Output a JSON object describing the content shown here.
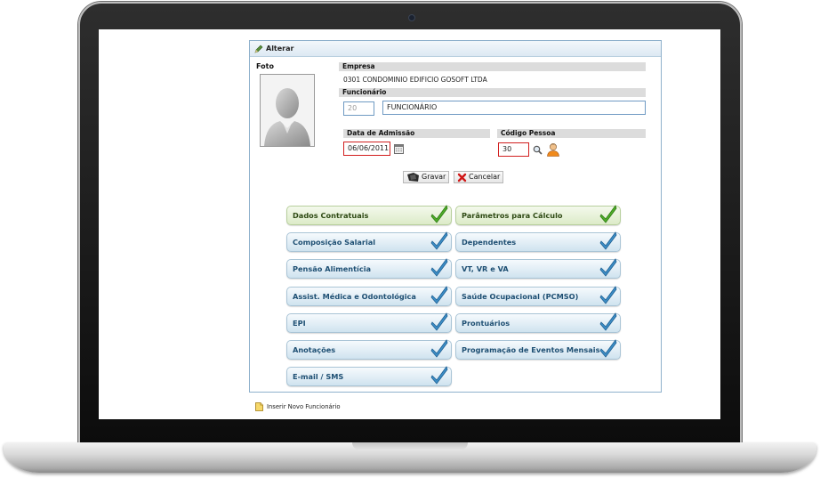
{
  "panel": {
    "title": "Alterar"
  },
  "photo": {
    "label": "Foto"
  },
  "empresa": {
    "label": "Empresa",
    "value": "0301 CONDOMINIO EDIFICIO GOSOFT LTDA"
  },
  "funcionario": {
    "label": "Funcionário",
    "code": "20",
    "name": "FUNCIONÁRIO"
  },
  "admissao": {
    "label": "Data de Admissão",
    "value": "06/06/2011"
  },
  "codigo_pessoa": {
    "label": "Código Pessoa",
    "value": "30"
  },
  "actions": {
    "save": "Gravar",
    "cancel": "Cancelar"
  },
  "menu": {
    "items": [
      {
        "label": "Dados Contratuais",
        "style": "green"
      },
      {
        "label": "Parâmetros para Cálculo",
        "style": "green"
      },
      {
        "label": "Composição Salarial",
        "style": "blue"
      },
      {
        "label": "Dependentes",
        "style": "blue"
      },
      {
        "label": "Pensão Alimentícia",
        "style": "blue"
      },
      {
        "label": "VT, VR e VA",
        "style": "blue"
      },
      {
        "label": "Assist. Médica e Odontológica",
        "style": "blue"
      },
      {
        "label": "Saúde Ocupacional (PCMSO)",
        "style": "blue"
      },
      {
        "label": "EPI",
        "style": "blue"
      },
      {
        "label": "Prontuários",
        "style": "blue"
      },
      {
        "label": "Anotações",
        "style": "blue"
      },
      {
        "label": "Programação de Eventos Mensais",
        "style": "blue"
      },
      {
        "label": "E-mail / SMS",
        "style": "blue"
      }
    ]
  },
  "footer": {
    "insert_label": "Inserir Novo Funcionário"
  },
  "colors": {
    "accent_blue": "#1e4f73",
    "accent_green": "#2e4a14",
    "required_border": "#d21f1f",
    "field_border": "#6f9ac3"
  }
}
